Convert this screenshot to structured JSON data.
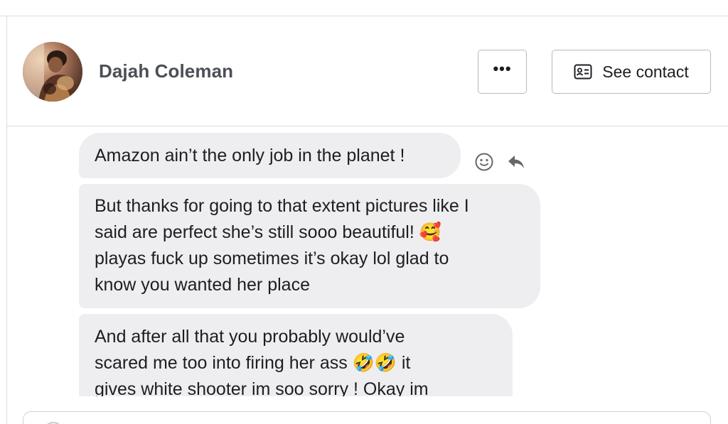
{
  "header": {
    "contact_name": "Dajah Coleman",
    "more_label": "•••",
    "see_contact_label": "See contact"
  },
  "icons": {
    "avatar": "profile-photo",
    "more": "more-icon",
    "contact": "contact-card-icon",
    "react": "smiley-icon",
    "reply": "reply-icon"
  },
  "messages": [
    {
      "lines": [
        "Amazon ain’t the only job in the planet !"
      ]
    },
    {
      "lines": [
        "But thanks for going to that extent pictures like I",
        "said are perfect she’s still sooo beautiful! 🥰",
        "playas fuck up sometimes it’s okay lol glad to",
        "know you wanted her place"
      ]
    },
    {
      "lines": [
        "And after all that you probably would’ve",
        "scared me too into firing her ass 🤣🤣 it",
        "gives white shooter im soo sorry ! Okay im"
      ]
    }
  ],
  "colors": {
    "bubble": "#eeeef0",
    "border": "#dcdde0",
    "name_text": "#4b4f56"
  }
}
